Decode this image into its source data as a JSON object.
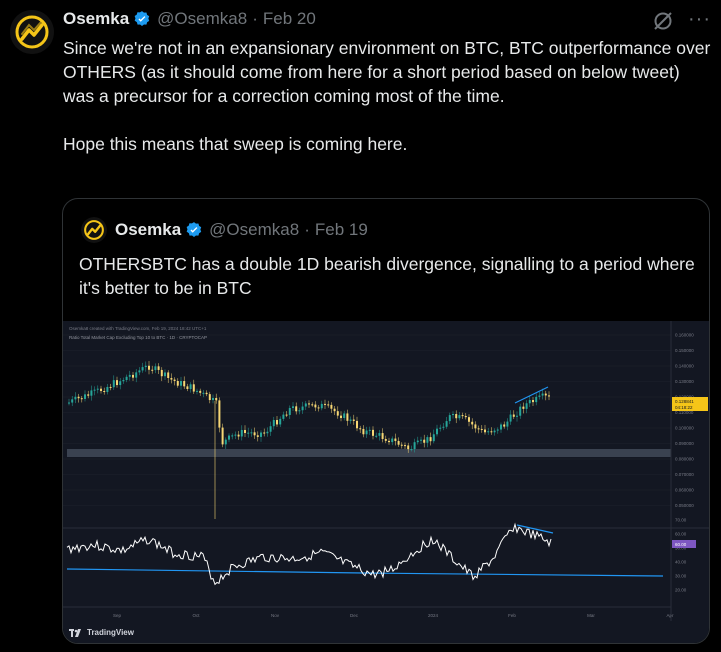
{
  "tweet": {
    "name": "Osemka",
    "handle": "@Osemka8",
    "separator": "·",
    "date": "Feb 20",
    "more_label": "···",
    "text_p1": "Since we're not in an expansionary environment on BTC, BTC outperformance over OTHERS (as it should come from here for a short period based on below tweet) was a precursor for a correction coming most of the time.",
    "text_p2": "Hope this means that sweep is coming here."
  },
  "quote": {
    "name": "Osemka",
    "handle": "@Osemka8",
    "separator": "·",
    "date": "Feb 19",
    "text": "OTHERSBTC has a double 1D bearish divergence, signalling to a period where it's better to be in BTC"
  },
  "chart_image": {
    "top_line": "Osemka8 created with TradingView.com, Feb 19, 2024 18:42 UTC+1",
    "symbol_line": "Ratio Total Market Cap Excluding Top 10 to BTC · 1D · CRYPTOCAP",
    "price_ticks": [
      "0.160000",
      "0.150000",
      "0.140000",
      "0.130000",
      "0.120000",
      "0.110000",
      "0.100000",
      "0.090000",
      "0.080000",
      "0.070000",
      "0.060000",
      "0.050000"
    ],
    "current_price": "0.128841",
    "current_sub": "04:18:22",
    "rsi_ticks": [
      "70.00",
      "60.00",
      "50.00",
      "40.00",
      "30.00",
      "20.00"
    ],
    "rsi_value": "60.00",
    "x_labels": [
      "Sep",
      "Oct",
      "Nov",
      "Dec",
      "2024",
      "Feb",
      "Mar",
      "Apr"
    ],
    "brand": "TradingView",
    "colors": {
      "up": "#26a69a",
      "down": "#f7d774",
      "rsi": "#ffffff",
      "trend": "#2196f3",
      "background": "#131722"
    }
  }
}
